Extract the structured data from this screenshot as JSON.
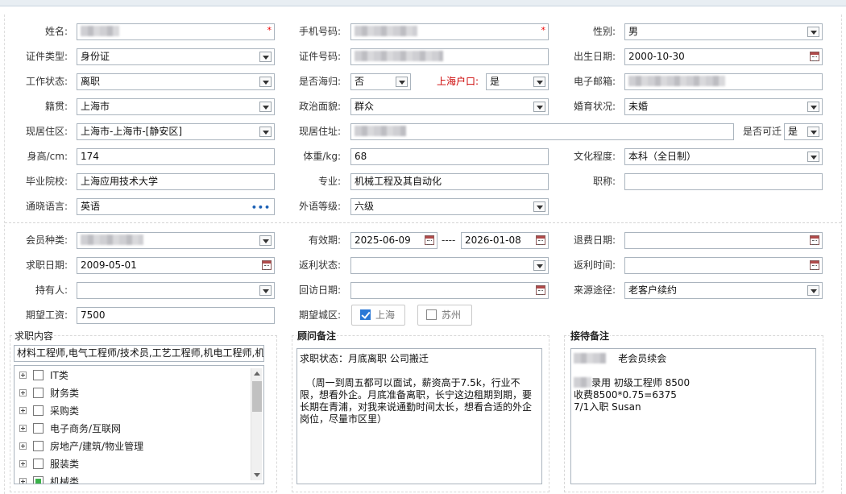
{
  "form": {
    "name": {
      "label": "姓名:",
      "value": ""
    },
    "phone": {
      "label": "手机号码:",
      "value": ""
    },
    "gender": {
      "label": "性别:",
      "value": "男"
    },
    "id_type": {
      "label": "证件类型:",
      "value": "身份证"
    },
    "id_number": {
      "label": "证件号码:",
      "value": ""
    },
    "birth_date": {
      "label": "出生日期:",
      "value": "2000-10-30"
    },
    "work_status": {
      "label": "工作状态:",
      "value": "离职"
    },
    "returnee": {
      "label": "是否海归:",
      "value": "否"
    },
    "shanghai_hukou": {
      "label": "上海户口:",
      "value": "是"
    },
    "email": {
      "label": "电子邮箱:",
      "value": ""
    },
    "native_place": {
      "label": "籍贯:",
      "value": "上海市"
    },
    "political_status": {
      "label": "政治面貌:",
      "value": "群众"
    },
    "marital_status": {
      "label": "婚育状况:",
      "value": "未婚"
    },
    "current_residence": {
      "label": "现居住区:",
      "value": "上海市-上海市-[静安区]"
    },
    "current_address": {
      "label": "现居住址:",
      "value": ""
    },
    "relocatable": {
      "label": "是否可迁",
      "value": "是"
    },
    "height": {
      "label": "身高/cm:",
      "value": "174"
    },
    "weight": {
      "label": "体重/kg:",
      "value": "68"
    },
    "education": {
      "label": "文化程度:",
      "value": "本科（全日制）"
    },
    "school": {
      "label": "毕业院校:",
      "value": "上海应用技术大学"
    },
    "major": {
      "label": "专业:",
      "value": "机械工程及其自动化"
    },
    "title": {
      "label": "职称:",
      "value": ""
    },
    "language": {
      "label": "通晓语言:",
      "value": "英语"
    },
    "language_level": {
      "label": "外语等级:",
      "value": "六级"
    },
    "member_type": {
      "label": "会员种类:",
      "value": ""
    },
    "validity": {
      "label": "有效期:",
      "from": "2025-06-09",
      "separator": "----",
      "to": "2026-01-08"
    },
    "refund_date": {
      "label": "退费日期:",
      "value": ""
    },
    "job_seek_date": {
      "label": "求职日期:",
      "value": "2009-05-01"
    },
    "rebate_status": {
      "label": "返利状态:",
      "value": ""
    },
    "rebate_time": {
      "label": "返利时间:",
      "value": ""
    },
    "holder": {
      "label": "持有人:",
      "value": ""
    },
    "revisit_date": {
      "label": "回访日期:",
      "value": ""
    },
    "source_channel": {
      "label": "来源途径:",
      "value": "老客户续约"
    },
    "expected_salary": {
      "label": "期望工资:",
      "value": "7500"
    },
    "expected_city": {
      "label": "期望城区:",
      "options": [
        {
          "label": "上海",
          "checked": true
        },
        {
          "label": "苏州",
          "checked": false
        }
      ]
    }
  },
  "job_content": {
    "heading": "求职内容",
    "summary": "材料工程师,电气工程师/技术员,工艺工程师,机电工程师,机",
    "tree": [
      {
        "label": "IT类",
        "state": "unchecked"
      },
      {
        "label": "财务类",
        "state": "unchecked"
      },
      {
        "label": "采购类",
        "state": "unchecked"
      },
      {
        "label": "电子商务/互联网",
        "state": "unchecked"
      },
      {
        "label": "房地产/建筑/物业管理",
        "state": "unchecked"
      },
      {
        "label": "服装类",
        "state": "unchecked"
      },
      {
        "label": "机械类",
        "state": "partial"
      }
    ]
  },
  "consultant_note": {
    "heading": "顾问备注",
    "text": "求职状态：月底离职 公司搬迁\n\n  （周一到周五都可以面试，薪资高于7.5k，行业不限，想看外企。月底准备离职，长宁这边租期到期，要长期在青浦，对我来说通勤时间太长，想看合适的外企岗位，尽量市区里）"
  },
  "reception_note": {
    "heading": "接待备注",
    "line1_suffix": "老会员续会",
    "line2_suffix": "录用  初级工程师 8500",
    "line3": "收费8500*0.75=6375",
    "line4": "7/1入职  Susan"
  },
  "colors": {
    "required_star": "#ee0000",
    "hukou_label": "#cc0000",
    "checkbox_accent": "#2a78d6",
    "tree_partial": "#3bb24a"
  }
}
